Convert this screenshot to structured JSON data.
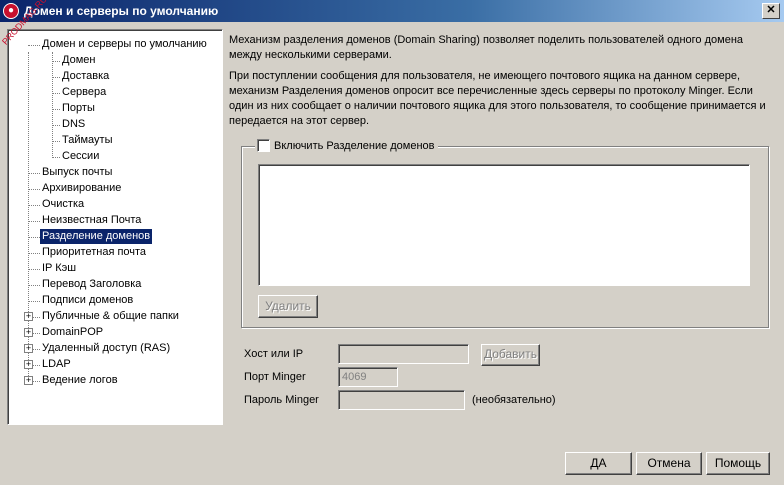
{
  "window": {
    "title": "Домен и серверы по умолчанию",
    "close_symbol": "✕"
  },
  "watermark": "PRODMAG.RU",
  "tree": {
    "root": "Домен и серверы по умолчанию",
    "children": [
      "Домен",
      "Доставка",
      "Сервера",
      "Порты",
      "DNS",
      "Таймауты",
      "Сессии"
    ],
    "items": [
      "Выпуск почты",
      "Архивирование",
      "Очистка",
      "Неизвестная Почта",
      "Разделение доменов",
      "Приоритетная почта",
      "IP Кэш",
      "Перевод Заголовка",
      "Подписи доменов"
    ],
    "expandable": [
      "Публичные & общие папки",
      "DomainPOP",
      "Удаленный доступ (RAS)",
      "LDAP",
      "Ведение логов"
    ],
    "selected": "Разделение доменов"
  },
  "description": {
    "para1": "Механизм разделения доменов (Domain Sharing) позволяет поделить пользователей одного домена между несколькими серверами.",
    "para2": "При поступлении сообщения для пользователя, не имеющего почтового ящика на данном сервере, механизм Разделения доменов опросит все перечисленные здесь серверы по протоколу Minger.  Если один из них сообщает о наличии почтового ящика для этого пользователя, то сообщение принимается и передается на этот сервер."
  },
  "group": {
    "enable_label": "Включить Разделение доменов",
    "checked": false,
    "delete_label": "Удалить"
  },
  "form": {
    "host_label": "Хост или IP",
    "host_value": "",
    "add_label": "Добавить",
    "port_label": "Порт Minger",
    "port_value": "4069",
    "password_label": "Пароль Minger",
    "password_value": "",
    "optional_label": "(необязательно)"
  },
  "footer": {
    "ok": "ДА",
    "cancel": "Отмена",
    "help": "Помощь"
  }
}
